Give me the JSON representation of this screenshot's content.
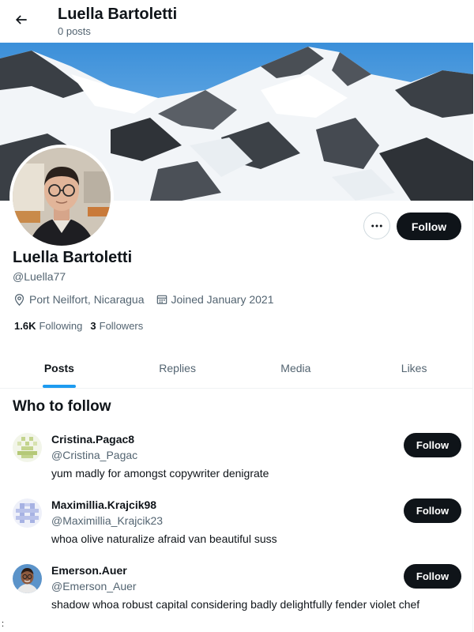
{
  "header": {
    "title": "Luella Bartoletti",
    "post_count": "0 posts"
  },
  "profile": {
    "display_name": "Luella Bartoletti",
    "handle": "@Luella77",
    "location": "Port Neilfort, Nicaragua",
    "joined": "Joined January 2021",
    "following_count": "1.6K",
    "following_label": "Following",
    "followers_count": "3",
    "followers_label": "Followers",
    "follow_label": "Follow"
  },
  "tabs": [
    {
      "label": "Posts",
      "active": true
    },
    {
      "label": "Replies",
      "active": false
    },
    {
      "label": "Media",
      "active": false
    },
    {
      "label": "Likes",
      "active": false
    }
  ],
  "who_to_follow": {
    "title": "Who to follow",
    "items": [
      {
        "name": "Cristina.Pagac8",
        "handle": "@Cristina_Pagac",
        "bio": "yum madly for amongst copywriter denigrate",
        "follow_label": "Follow"
      },
      {
        "name": "Maximillia.Krajcik98",
        "handle": "@Maximillia_Krajcik23",
        "bio": "whoa olive naturalize afraid van beautiful suss",
        "follow_label": "Follow"
      },
      {
        "name": "Emerson.Auer",
        "handle": "@Emerson_Auer",
        "bio": "shadow whoa robust capital considering badly delightfully fender violet chef",
        "follow_label": "Follow"
      }
    ]
  },
  "stray_char": ":",
  "icons": {
    "back": "arrow-left-icon",
    "more": "more-horizontal-icon",
    "location": "location-pin-icon",
    "calendar": "calendar-icon"
  },
  "colors": {
    "accent": "#1d9bf0",
    "button_dark": "#0f1419",
    "secondary_text": "#536471"
  }
}
